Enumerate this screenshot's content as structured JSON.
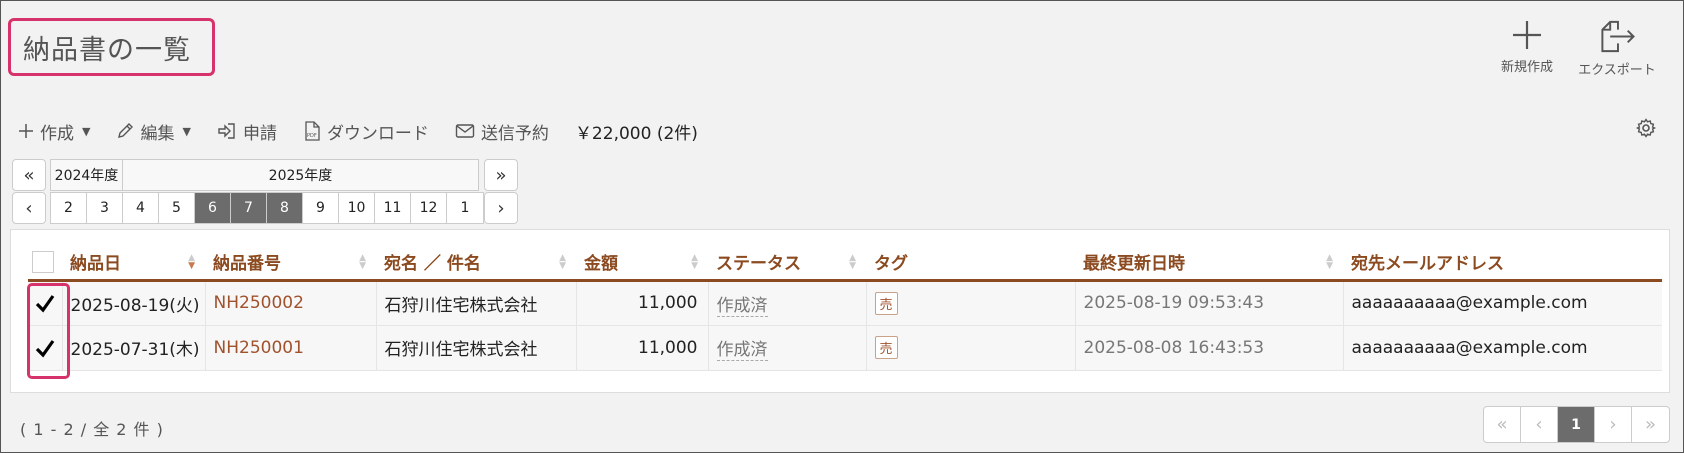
{
  "page": {
    "title": "納品書の一覧",
    "actions": [
      {
        "label": "新規作成",
        "icon": "plus-icon"
      },
      {
        "label": "エクスポート",
        "icon": "export-icon"
      }
    ]
  },
  "toolbar": {
    "create_label": "作成",
    "edit_label": "編集",
    "apply_label": "申請",
    "download_label": "ダウンロード",
    "schedule_label": "送信予約",
    "total_label": "￥22,000 (2件)"
  },
  "period": {
    "prev_year": "«",
    "next_year": "»",
    "prev_month": "‹",
    "next_month": "›",
    "year_2024": "2024年度",
    "year_2025": "2025年度",
    "months": [
      "2",
      "3",
      "4",
      "5",
      "6",
      "7",
      "8",
      "9",
      "10",
      "11",
      "12",
      "1"
    ],
    "selected_months": [
      "6",
      "7",
      "8"
    ]
  },
  "table": {
    "headers": {
      "date": "納品日",
      "number": "納品番号",
      "addressee": "宛名 ／ 件名",
      "amount": "金額",
      "status": "ステータス",
      "tag": "タグ",
      "updated": "最終更新日時",
      "email": "宛先メールアドレス"
    },
    "rows": [
      {
        "checked": true,
        "date": "2025-08-19(火)",
        "number": "NH250002",
        "addressee": "石狩川住宅株式会社",
        "amount": "11,000",
        "status": "作成済",
        "tag": "売",
        "updated": "2025-08-19 09:53:43",
        "email": "aaaaaaaaaa@example.com"
      },
      {
        "checked": true,
        "date": "2025-07-31(木)",
        "number": "NH250001",
        "addressee": "石狩川住宅株式会社",
        "amount": "11,000",
        "status": "作成済",
        "tag": "売",
        "updated": "2025-08-08 16:43:53",
        "email": "aaaaaaaaaa@example.com"
      }
    ]
  },
  "footer": {
    "count_label": "( 1 - 2 / 全 2 件 )",
    "pager": {
      "first": "«",
      "prev": "‹",
      "current": "1",
      "next": "›",
      "last": "»"
    }
  },
  "colors": {
    "accent": "#8b4a1f",
    "highlight": "#d6336c",
    "selected": "#6c6c6c"
  }
}
